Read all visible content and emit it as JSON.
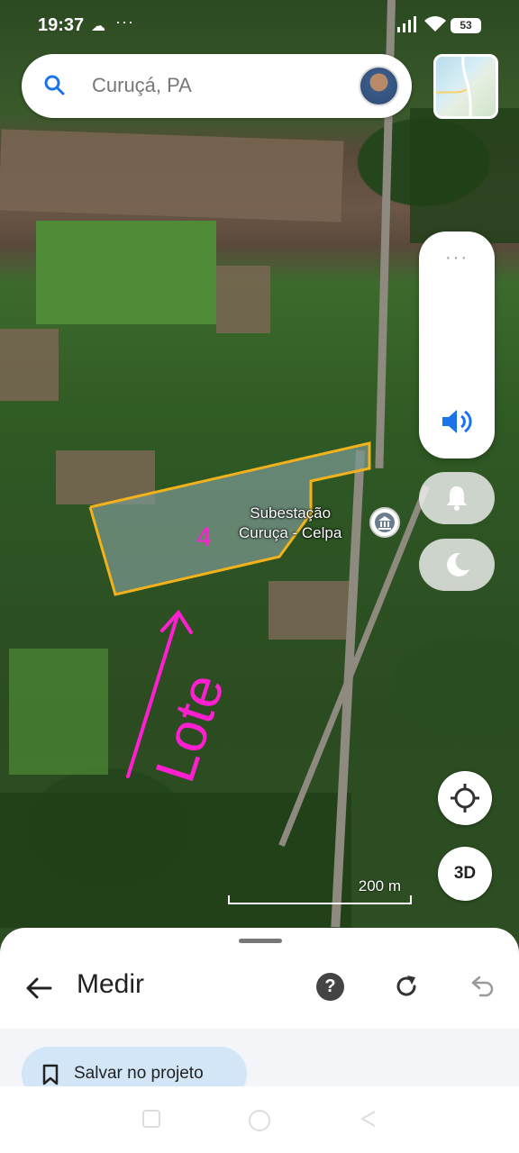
{
  "status_bar": {
    "time": "19:37",
    "more": "···",
    "battery": "53"
  },
  "search": {
    "value": "Curuçá, PA"
  },
  "volume_panel": {
    "more": "···"
  },
  "map": {
    "poi_line1": "Subestação",
    "poi_line2": "Curuça - Celpa",
    "annotation_number": "4",
    "annotation_word": "Lote",
    "scale_label": "200 m",
    "parcel_outline_color": "#f2b21c",
    "annotation_color": "#ff1fd0"
  },
  "controls": {
    "btn_3d": "3D"
  },
  "sheet": {
    "title": "Medir",
    "help": "?",
    "save_label": "Salvar no projeto"
  },
  "icons": {
    "search": "search-icon",
    "back": "arrow-left-icon",
    "help": "help-icon",
    "redo": "redo-icon",
    "undo": "undo-icon",
    "bookmark": "bookmark-icon",
    "locate": "my-location-icon",
    "speaker": "speaker-icon",
    "bell": "bell-icon",
    "moon": "moon-icon"
  }
}
